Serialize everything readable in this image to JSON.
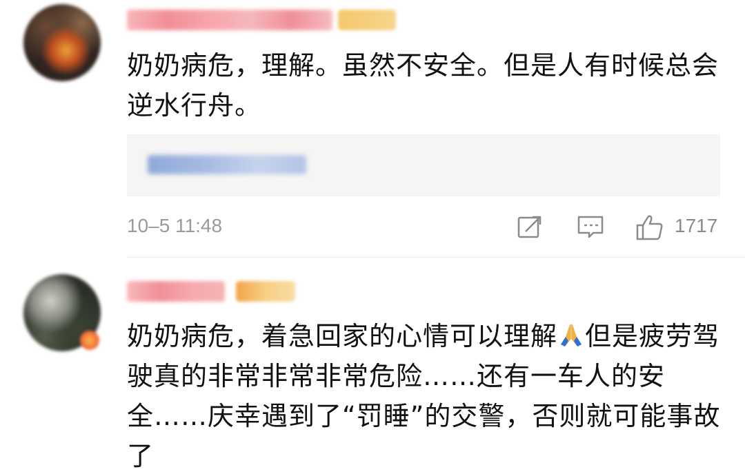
{
  "comments": [
    {
      "text": "奶奶病危，理解。虽然不安全。但是人有时候总会逆水行舟。",
      "time": "10–5 11:48",
      "likes": "1717",
      "icons": [
        "share-icon",
        "comment-icon",
        "like-icon"
      ]
    },
    {
      "text_before_emoji": "奶奶病危，着急回家的心情可以理解",
      "emoji": "folded-hands-icon",
      "text_after_emoji": "但是疲劳驾驶真的非常非常非常危险……还有一车人的安全……庆幸遇到了“罚睡”的交警，否则就可能事故了"
    }
  ],
  "colors": {
    "text": "#111111",
    "meta": "#9a9a9a",
    "reply_box_bg": "#f5f5f5",
    "blur_pink": "#f6b2b7",
    "blur_gold": "#f4c86b"
  }
}
